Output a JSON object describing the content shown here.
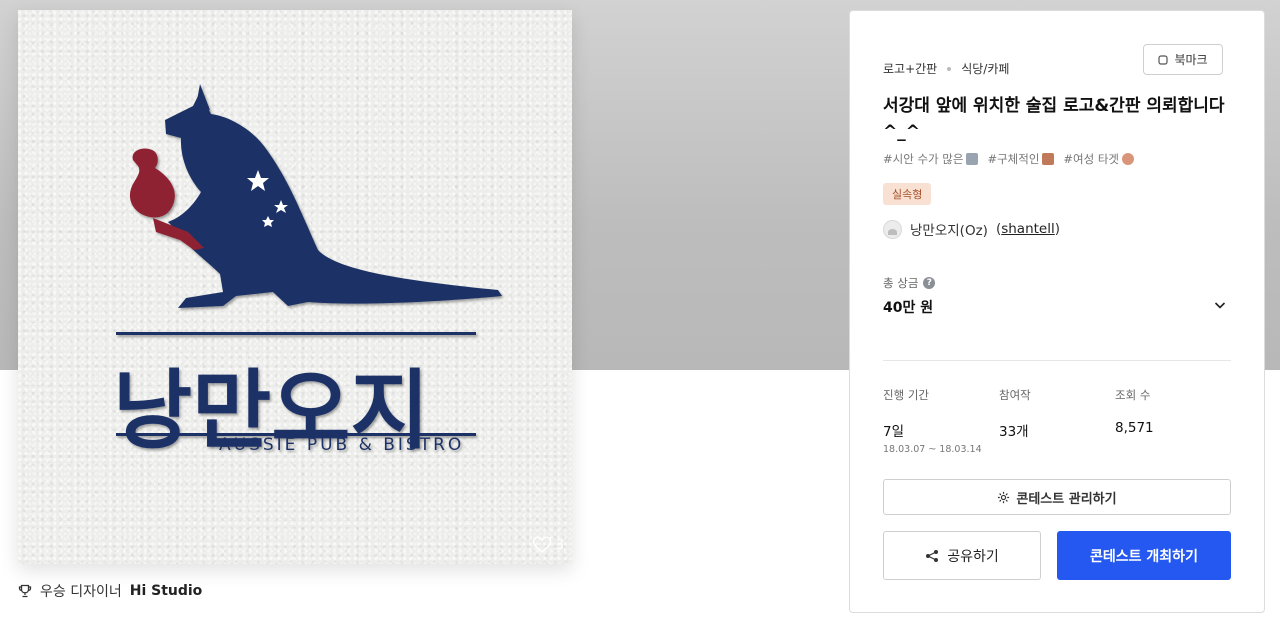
{
  "preview": {
    "logo_korean": "낭만오지",
    "logo_tagline": "AUSSIE PUB & BISTRO",
    "likes": "3",
    "colors": {
      "navy": "#1f3366",
      "red": "#8e2030",
      "paper": "#ededeb"
    }
  },
  "winner": {
    "label": "우승 디자이너",
    "name": "Hi Studio",
    "icon": "trophy-icon"
  },
  "panel": {
    "breadcrumb": [
      "로고+간판",
      "식당/카페"
    ],
    "bookmark_label": "북마크",
    "title": "서강대 앞에 위치한 술집 로고&간판 의뢰합니다 ^_^",
    "tags": [
      "#시안 수가 많은",
      "#구체적인",
      "#여성 타겟"
    ],
    "badge": "실속형",
    "host": {
      "name": "낭만오지(Oz)",
      "id": "shantell"
    },
    "prize": {
      "label": "총 상금",
      "value": "40만 원"
    },
    "stats": [
      {
        "label": "진행 기간",
        "value": "7일",
        "sub": "18.03.07 ~ 18.03.14"
      },
      {
        "label": "참여작",
        "value": "33개",
        "sub": ""
      },
      {
        "label": "조회 수",
        "value": "8,571",
        "sub": ""
      }
    ],
    "manage_label": "콘테스트 관리하기",
    "share_label": "공유하기",
    "open_label": "콘테스트 개최하기",
    "accent": "#2458f0"
  }
}
